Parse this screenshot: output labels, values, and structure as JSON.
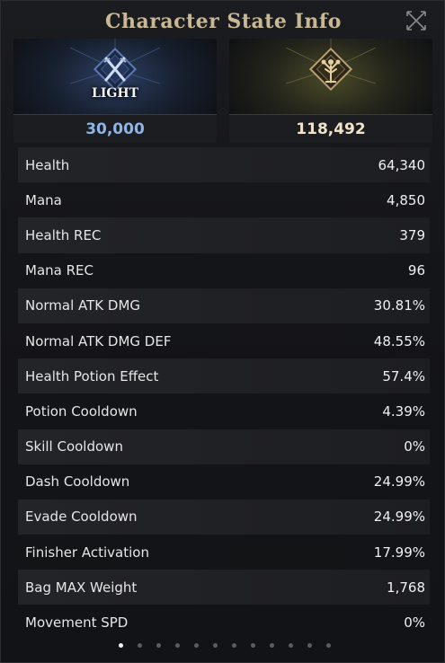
{
  "window": {
    "title": "Character State Info"
  },
  "tiers": [
    {
      "name": "LIGHT",
      "value": "30,000",
      "emblem": "crossed-swords-icon",
      "accent": "#8fb4e6"
    },
    {
      "name": "",
      "value": "118,492",
      "emblem": "tree-icon",
      "accent": "#c9b896"
    }
  ],
  "stats": [
    {
      "label": "Health",
      "value": "64,340"
    },
    {
      "label": "Mana",
      "value": "4,850"
    },
    {
      "label": "Health REC",
      "value": "379"
    },
    {
      "label": "Mana REC",
      "value": "96"
    },
    {
      "label": "Normal ATK DMG",
      "value": "30.81%"
    },
    {
      "label": "Normal ATK DMG DEF",
      "value": "48.55%"
    },
    {
      "label": "Health Potion Effect",
      "value": "57.4%"
    },
    {
      "label": "Potion Cooldown",
      "value": "4.39%"
    },
    {
      "label": "Skill Cooldown",
      "value": "0%"
    },
    {
      "label": "Dash Cooldown",
      "value": "24.99%"
    },
    {
      "label": "Evade Cooldown",
      "value": "24.99%"
    },
    {
      "label": "Finisher Activation",
      "value": "17.99%"
    },
    {
      "label": "Bag MAX Weight",
      "value": "1,768"
    },
    {
      "label": "Movement SPD",
      "value": "0%"
    }
  ],
  "pager": {
    "total": 12,
    "active": 1
  }
}
